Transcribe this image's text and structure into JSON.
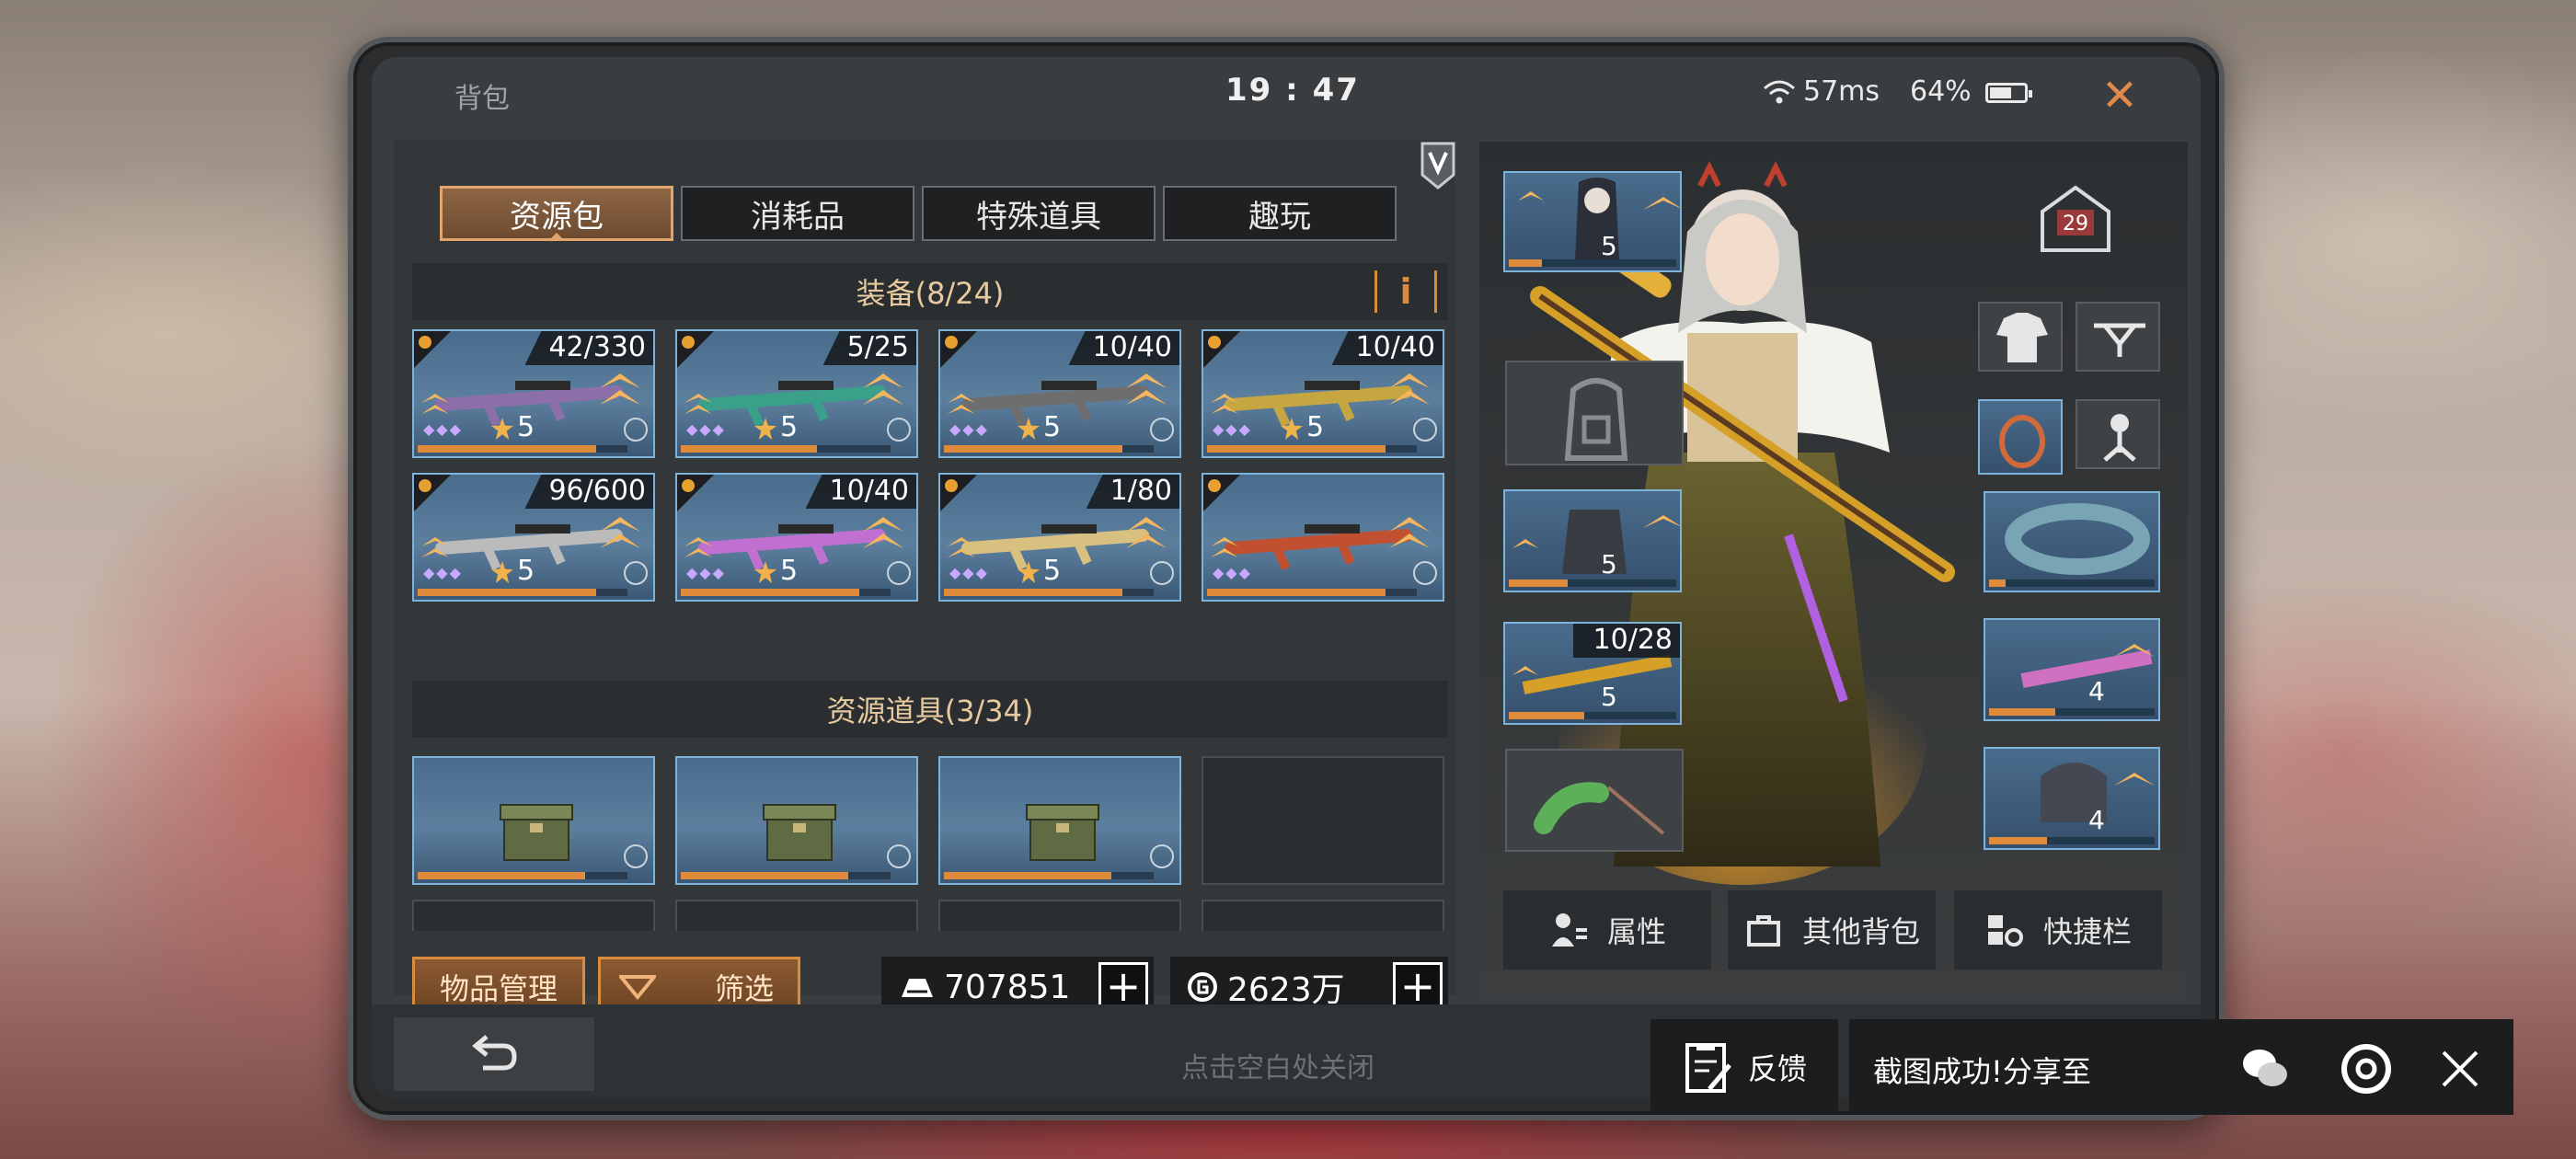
{
  "status_bar": {
    "title": "背包",
    "time": "19 : 47",
    "ping": "57ms",
    "battery": "64%",
    "battery_level": 0.64
  },
  "tabs": [
    {
      "label": "资源包",
      "active": true
    },
    {
      "label": "消耗品",
      "active": false
    },
    {
      "label": "特殊道具",
      "active": false
    },
    {
      "label": "趣玩",
      "active": false
    }
  ],
  "equipment": {
    "header": "装备(8/24)",
    "info_label": "i",
    "items": [
      {
        "count": "42/330",
        "level": "5",
        "weapon_color": "#8c6fa8",
        "progress": 0.85
      },
      {
        "count": "5/25",
        "level": "5",
        "weapon_color": "#3aa08a",
        "progress": 0.65
      },
      {
        "count": "10/40",
        "level": "5",
        "weapon_color": "#6e6e6e",
        "progress": 0.85
      },
      {
        "count": "10/40",
        "level": "5",
        "weapon_color": "#c6a640",
        "progress": 0.85
      },
      {
        "count": "96/600",
        "level": "5",
        "weapon_color": "#bbbbbb",
        "progress": 0.85
      },
      {
        "count": "10/40",
        "level": "5",
        "weapon_color": "#c070d0",
        "progress": 0.85
      },
      {
        "count": "1/80",
        "level": "5",
        "weapon_color": "#d8c080",
        "progress": 0.85
      },
      {
        "count": "",
        "level": "",
        "weapon_color": "#c05030",
        "progress": 0.85
      }
    ]
  },
  "resources": {
    "header": "资源道具(3/34)"
  },
  "buttons": {
    "manage": "物品管理",
    "filter": "筛选"
  },
  "currency": {
    "gold": "707851",
    "coins": "2623万"
  },
  "character": {
    "level": "29",
    "equip_levels": [
      "5",
      "5",
      "5",
      "4",
      "4"
    ],
    "equip_count": "10/28"
  },
  "char_buttons": {
    "attributes": "属性",
    "other_bags": "其他背包",
    "shortcut": "快捷栏"
  },
  "footer": {
    "tap_close": "点击空白处关闭"
  },
  "share": {
    "feedback": "反馈",
    "text": "截图成功!分享至"
  },
  "colors": {
    "accent": "#d98c3e",
    "slot_border": "#7eb2d8"
  }
}
